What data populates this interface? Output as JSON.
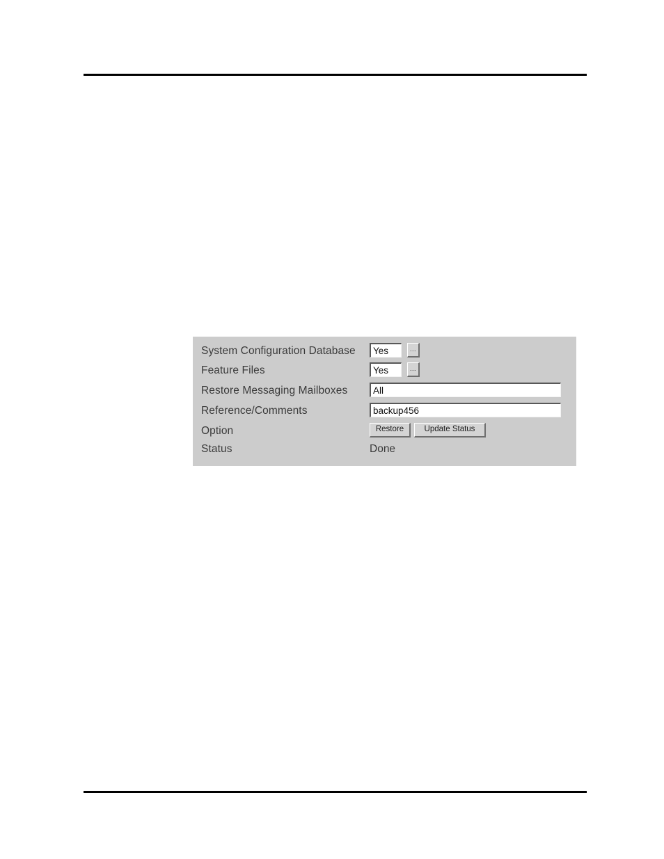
{
  "document": {
    "background_color": "#ffffff",
    "rule_color": "#000000"
  },
  "panel": {
    "background_color": "#cccccc",
    "rows": [
      {
        "label": "System Configuration Database",
        "control": "select-with-browse",
        "value": "Yes",
        "browse_label": "..."
      },
      {
        "label": "Feature Files",
        "control": "select-with-browse",
        "value": "Yes",
        "browse_label": "..."
      },
      {
        "label": "Restore Messaging Mailboxes",
        "control": "text",
        "value": "All"
      },
      {
        "label": "Reference/Comments",
        "control": "text",
        "value": "backup456"
      },
      {
        "label": "Option",
        "control": "buttons",
        "buttons": [
          {
            "label": "Restore"
          },
          {
            "label": "Update Status"
          }
        ]
      },
      {
        "label": "Status",
        "control": "static-text",
        "value": "Done"
      }
    ]
  }
}
